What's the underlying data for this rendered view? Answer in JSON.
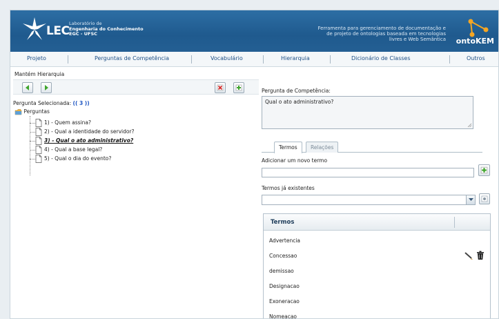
{
  "header": {
    "logo": "LEC",
    "lab_lines": [
      "Laboratório de",
      "Engenharia do Conhecimento",
      "EGC - UFSC"
    ],
    "tagline": [
      "Ferramenta para gerenciamento de documentação e",
      "de projeto de ontologias baseada em tecnologias",
      "livres e Web Semântica"
    ],
    "product": "ontoKEM"
  },
  "menu": [
    "Projeto",
    "Perguntas de Competência",
    "Vocabulário",
    "Hierarquia",
    "Dicionário de Classes",
    "Outros"
  ],
  "left": {
    "title": "Mantém Hierarquia",
    "selected_label": "Pergunta Selecionada:",
    "selected_value": "(( 3 ))",
    "tree_root": "Perguntas",
    "items": [
      "1) - Quem assina?",
      "2) - Qual a identidade do servidor?",
      "3) - Qual o ato administrativo?",
      "4) - Qual a base legal?",
      "5) - Qual o dia do evento?"
    ],
    "active_index": 2
  },
  "right": {
    "question_label": "Pergunta de Competência:",
    "question_value": "Qual o ato administrativo?",
    "tabs": [
      "Termos",
      "Relações"
    ],
    "add_label": "Adicionar um novo termo",
    "add_value": "",
    "existing_label": "Termos já existentes",
    "existing_value": "",
    "grid_header": "Termos",
    "terms": [
      "Advertencia",
      "Concessao",
      "demissao",
      "Designacao",
      "Exoneracao",
      "Nomeacao"
    ],
    "actions_row": 1
  },
  "colors": {
    "header_blue": "#245f93",
    "menu_text": "#1d4f86",
    "link_blue": "#1d55c2",
    "add_green": "#3fa52c",
    "delete_red": "#d22a2a"
  }
}
